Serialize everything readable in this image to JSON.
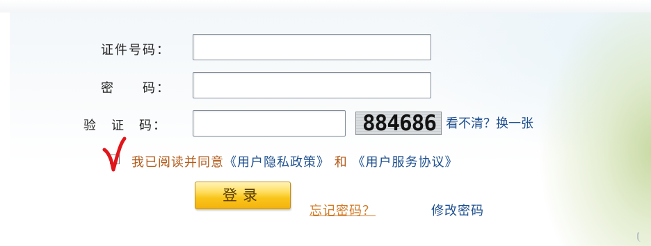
{
  "form": {
    "id_label": "证件号码：",
    "id_value": "",
    "password_label": "密　　码：",
    "password_value": "",
    "captcha_label": "验　证　码：",
    "captcha_value": "",
    "captcha_image_text": "884686",
    "refresh_captcha_link": "看不清？换一张",
    "agreement": {
      "checked": true,
      "prefix": "我已阅读并同意",
      "privacy_link": "《用户隐私政策》",
      "conjunction": "和",
      "service_link": "《用户服务协议》"
    },
    "login_button": "登录",
    "forgot_password_link": "忘记密码？",
    "change_password_link": "修改密码"
  },
  "colors": {
    "accent_link": "#1d4f8f",
    "agreement_text": "#b25a19",
    "forgot_link": "#d27a26",
    "button_yellow": "#f9c51b",
    "tick_red": "#e0161b"
  }
}
